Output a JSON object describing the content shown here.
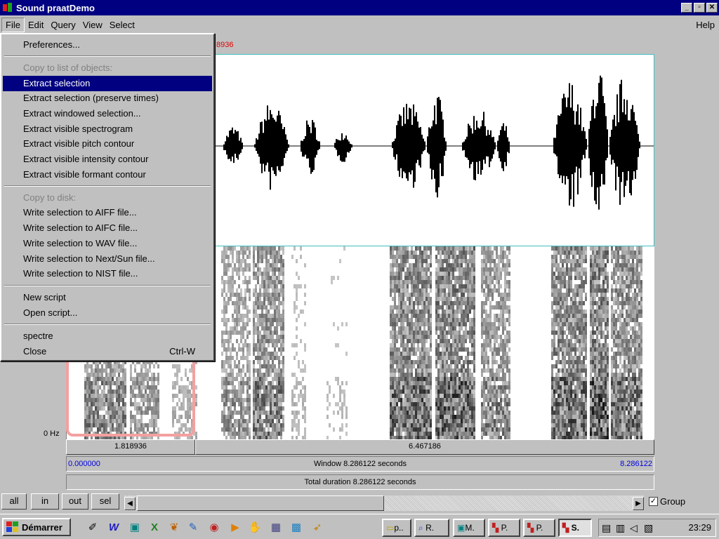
{
  "window": {
    "title": "Sound praatDemo"
  },
  "menubar": {
    "items": [
      "File",
      "Edit",
      "Query",
      "View",
      "Select"
    ],
    "help": "Help"
  },
  "file_menu": {
    "items": [
      {
        "label": "Preferences..."
      },
      {
        "label": "Copy to list of objects:"
      },
      {
        "label": "Extract selection"
      },
      {
        "label": "Extract selection (preserve times)"
      },
      {
        "label": "Extract windowed selection..."
      },
      {
        "label": "Extract visible spectrogram"
      },
      {
        "label": "Extract visible pitch contour"
      },
      {
        "label": "Extract visible intensity contour"
      },
      {
        "label": "Extract visible formant contour"
      },
      {
        "label": "Copy to disk:"
      },
      {
        "label": "Write selection to AIFF file..."
      },
      {
        "label": "Write selection to AIFC file..."
      },
      {
        "label": "Write selection to WAV file..."
      },
      {
        "label": "Write selection to Next/Sun file..."
      },
      {
        "label": "Write selection to NIST file..."
      },
      {
        "label": "New script"
      },
      {
        "label": "Open script..."
      },
      {
        "label": "spectre"
      },
      {
        "label": "Close",
        "shortcut": "Ctrl-W"
      }
    ],
    "selected": "Extract selection"
  },
  "editor": {
    "selection_end_red": "8936",
    "freq_bottom_label": "0 Hz",
    "selection_duration": "1.818936",
    "remaining_duration": "6.467186",
    "window_start": "0.000000",
    "window_label": "Window 8.286122 seconds",
    "window_end": "8.286122",
    "total_label": "Total duration 8.286122 seconds"
  },
  "controls": {
    "all": "all",
    "in": "in",
    "out": "out",
    "sel": "sel",
    "group_label": "Group",
    "group_checked": true
  },
  "taskbar": {
    "start": "Démarrer",
    "tasks": [
      "p..",
      "R.",
      "M.",
      "P.",
      "P.",
      "S."
    ],
    "active_task": "S.",
    "clock": "23:29"
  },
  "colors": {
    "titlebar": "#000080",
    "selection_red": "#e00000",
    "time_blue": "#0000e0",
    "selection_box": "#f4a0a0"
  }
}
